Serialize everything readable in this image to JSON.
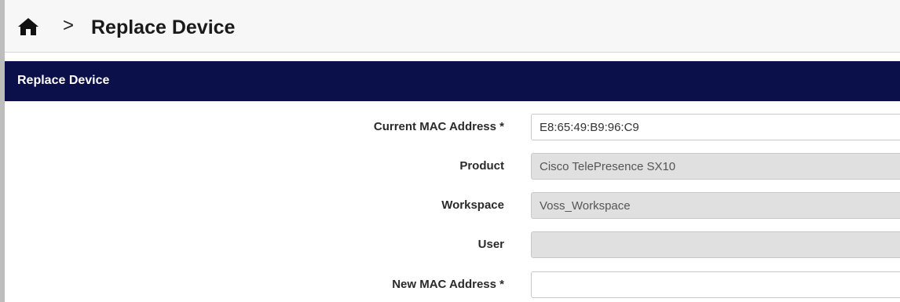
{
  "header": {
    "breadcrumb_separator": ">",
    "title": "Replace Device",
    "home_icon": "home-icon"
  },
  "panel": {
    "title": "Replace Device"
  },
  "form": {
    "current_mac": {
      "label": "Current MAC Address *",
      "value": "E8:65:49:B9:96:C9"
    },
    "product": {
      "label": "Product",
      "value": "Cisco TelePresence SX10"
    },
    "workspace": {
      "label": "Workspace",
      "value": "Voss_Workspace"
    },
    "user": {
      "label": "User",
      "value": ""
    },
    "new_mac": {
      "label": "New MAC Address *",
      "value": ""
    }
  },
  "colors": {
    "panel_header_bg": "#0b0f4a",
    "readonly_bg": "#e0e0e0"
  }
}
